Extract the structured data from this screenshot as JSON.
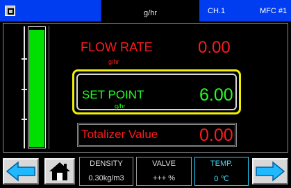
{
  "header": {
    "unit": "g/hr",
    "channel": "CH.1",
    "mfc": "MFC #1"
  },
  "gauge": {
    "fill_fraction": 0.98
  },
  "flow_rate": {
    "label": "FLOW RATE",
    "unit": "g/hr",
    "value": "0.00"
  },
  "set_point": {
    "label": "SET POINT",
    "unit": "g/hr",
    "value": "6.00"
  },
  "totalizer": {
    "label": "Totalizer Value",
    "value": "0.00"
  },
  "footer": {
    "density": {
      "title": "DENSITY",
      "value": "0.30kg/m3"
    },
    "valve": {
      "title": "VALVE",
      "value": "+++ %"
    },
    "temp": {
      "title": "TEMP.",
      "value": "0 ℃"
    }
  },
  "colors": {
    "header_blue": "#003cf0",
    "alarm_red": "#ff1a1a",
    "setpoint_green": "#20ff20",
    "highlight_yellow": "#f0f000",
    "temp_cyan": "#40e0ff"
  },
  "icons": {
    "menu": "menu-icon",
    "prev": "arrow-left-icon",
    "next": "arrow-right-icon",
    "home": "home-icon"
  }
}
